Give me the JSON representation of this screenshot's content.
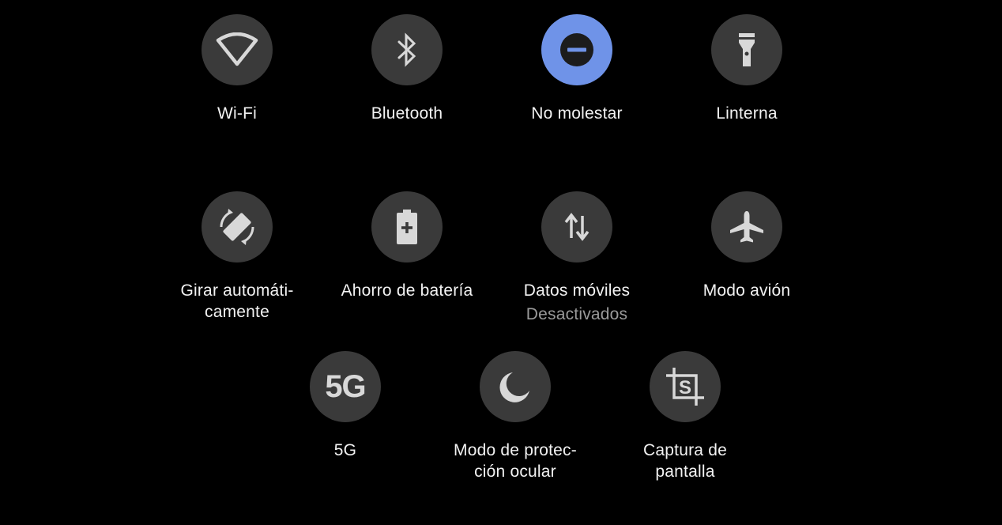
{
  "tiles": [
    {
      "label": "Wi-Fi",
      "icon": "wifi-icon",
      "active": false
    },
    {
      "label": "Bluetooth",
      "icon": "bluetooth-icon",
      "active": false
    },
    {
      "label": "No molestar",
      "icon": "do-not-disturb-icon",
      "active": true
    },
    {
      "label": "Linterna",
      "icon": "flashlight-icon",
      "active": false
    },
    {
      "label": "Girar automáti-\ncamente",
      "icon": "auto-rotate-icon",
      "active": false
    },
    {
      "label": "Ahorro de batería",
      "icon": "battery-saver-icon",
      "active": false
    },
    {
      "label": "Datos móviles",
      "sublabel": "Desactivados",
      "icon": "mobile-data-icon",
      "active": false
    },
    {
      "label": "Modo avión",
      "icon": "airplane-icon",
      "active": false
    },
    {
      "label": "5G",
      "icon": "5g-icon",
      "icon_text": "5G",
      "active": false
    },
    {
      "label": "Modo de protec-\nción ocular",
      "icon": "moon-icon",
      "active": false
    },
    {
      "label": "Captura de\npantalla",
      "icon": "screenshot-icon",
      "active": false
    }
  ],
  "colors": {
    "background": "#000000",
    "tile_inactive": "#3a3a3a",
    "tile_active": "#6f93e8",
    "icon": "#d8d8d8",
    "label": "#f2f2f2",
    "sublabel": "#9a9a9a"
  }
}
